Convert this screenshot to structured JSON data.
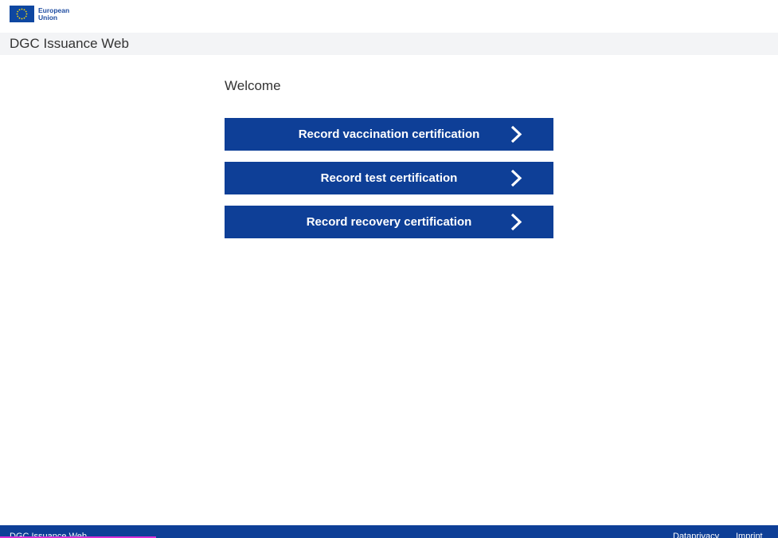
{
  "header": {
    "logo_line1": "European",
    "logo_line2": "Union",
    "app_title": "DGC Issuance Web"
  },
  "main": {
    "welcome": "Welcome",
    "buttons": [
      {
        "label": "Record vaccination certification",
        "icon": "chevron-right-icon"
      },
      {
        "label": "Record test certification",
        "icon": "chevron-right-icon"
      },
      {
        "label": "Record recovery certification",
        "icon": "chevron-right-icon"
      }
    ]
  },
  "footer": {
    "title": "DGC Issuance Web",
    "links": [
      "Dataprivacy",
      "Imprint"
    ]
  },
  "colors": {
    "primary": "#0e3f97",
    "eu_blue": "#0e47a1",
    "eu_star": "#ffdd00",
    "title_bar_bg": "#f3f4f6",
    "focus_underline": "#d62fd6"
  }
}
